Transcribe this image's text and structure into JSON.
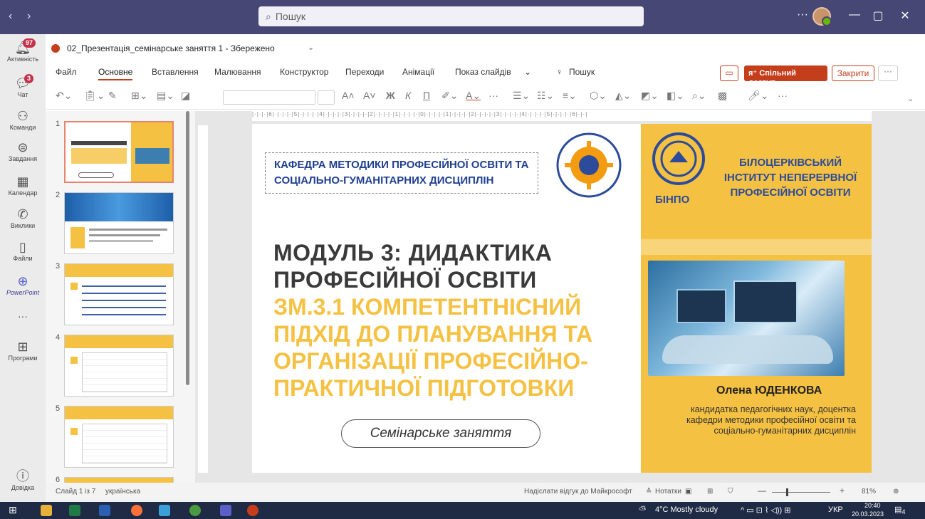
{
  "teams": {
    "search_placeholder": "Пошук",
    "more": "···"
  },
  "rail": {
    "items": [
      {
        "label": "Активність",
        "badge": "97"
      },
      {
        "label": "Чат",
        "badge": "3"
      },
      {
        "label": "Команди"
      },
      {
        "label": "Завдання"
      },
      {
        "label": "Календар"
      },
      {
        "label": "Виклики"
      },
      {
        "label": "Файли"
      },
      {
        "label": "PowerPoint"
      },
      {
        "label": "···"
      },
      {
        "label": "Програми"
      },
      {
        "label": "Довідка"
      }
    ]
  },
  "doc": {
    "title": "02_Презентація_семінарське заняття 1  -  Збережено"
  },
  "menu": {
    "items": [
      "Файл",
      "Основне",
      "Вставлення",
      "Малювання",
      "Конструктор",
      "Переходи",
      "Анімації",
      "Показ слайдів"
    ],
    "search": "Пошук",
    "share": "Спільний доступ",
    "close": "Закрити",
    "more": "···"
  },
  "ribbon": {
    "bold": "Ж",
    "italic": "К",
    "underline": "П",
    "more": "···"
  },
  "thumbnails": [
    {
      "num": "1"
    },
    {
      "num": "2"
    },
    {
      "num": "3"
    },
    {
      "num": "4"
    },
    {
      "num": "5"
    },
    {
      "num": "6"
    }
  ],
  "slide": {
    "dept": "КАФЕДРА МЕТОДИКИ ПРОФЕСІЙНОЇ ОСВІТИ ТА СОЦІАЛЬНО-ГУМАНІТАРНИХ ДИСЦИПЛІН",
    "title": "МОДУЛЬ 3: ДИДАКТИКА ПРОФЕСІЙНОЇ ОСВІТИ",
    "subtitle": "ЗМ.3.1 КОМПЕТЕНТНІСНИЙ ПІДХІД ДО ПЛАНУВАННЯ ТА ОРГАНІЗАЦІЇ ПРОФЕСІЙНО-ПРАКТИЧНОЇ ПІДГОТОВКИ",
    "seminar": "Семінарське заняття",
    "inst_abbr": "БІНПО",
    "inst_name": "БІЛОЦЕРКІВСЬКИЙ ІНСТИТУТ НЕПЕРЕРВНОЇ ПРОФЕСІЙНОЇ ОСВІТИ",
    "author": "Олена ЮДЕНКОВА",
    "author_info": "кандидатка педагогічних наук, доцентка кафедри методики професійної освіти та соціально-гуманітарних дисциплін"
  },
  "status": {
    "slide_of": "Слайд 1 із 7",
    "language": "українська",
    "feedback": "Надіслати відгук до Майкрософт",
    "notes": "Нотатки",
    "zoom": "81%"
  },
  "taskbar": {
    "weather": "4°C  Mostly cloudy",
    "lang": "УКР",
    "time": "20:40",
    "date": "20.03.2023",
    "notif": "4"
  },
  "colors": {
    "teams_bar": "#464775",
    "ppt_accent": "#c43e1c",
    "slide_yellow": "#f5c142",
    "slide_blue": "#2c4b9a"
  }
}
